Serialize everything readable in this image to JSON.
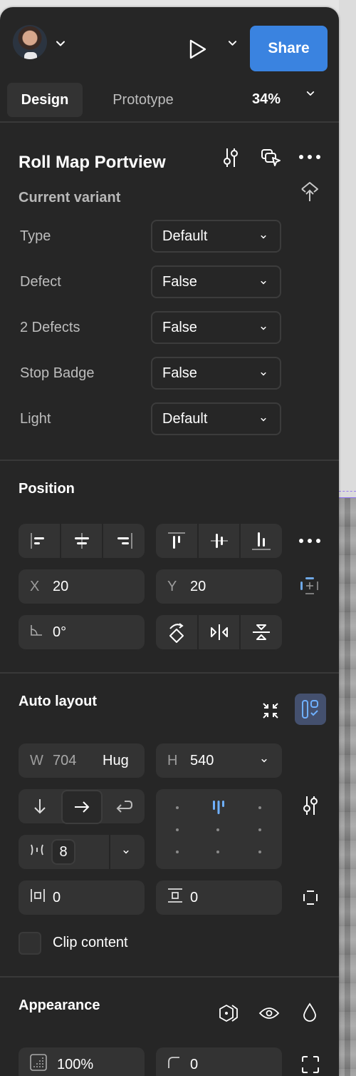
{
  "header": {
    "share_label": "Share",
    "tabs": [
      {
        "label": "Design",
        "active": true
      },
      {
        "label": "Prototype",
        "active": false
      }
    ],
    "zoom_level": "34%",
    "accent_color": "#3a83e0"
  },
  "component": {
    "name": "Roll Map Portview",
    "subtitle": "Current variant",
    "properties": [
      {
        "label": "Type",
        "value": "Default"
      },
      {
        "label": "Defect",
        "value": "False"
      },
      {
        "label": "2 Defects",
        "value": "False"
      },
      {
        "label": "Stop Badge",
        "value": "False"
      },
      {
        "label": "Light",
        "value": "Default"
      }
    ]
  },
  "position": {
    "title": "Position",
    "x_label": "X",
    "x_value": "20",
    "y_label": "Y",
    "y_value": "20",
    "rotation_value": "0°"
  },
  "auto_layout": {
    "title": "Auto layout",
    "w_label": "W",
    "w_value": "704",
    "w_mode": "Hug",
    "h_label": "H",
    "h_value": "540",
    "direction": "horizontal",
    "gap_value": "8",
    "padding_horizontal": "0",
    "padding_vertical": "0",
    "clip_content_label": "Clip content",
    "clip_content_checked": false,
    "alignment": "top-center"
  },
  "appearance": {
    "title": "Appearance",
    "opacity_value": "100%",
    "corner_radius_value": "0"
  }
}
